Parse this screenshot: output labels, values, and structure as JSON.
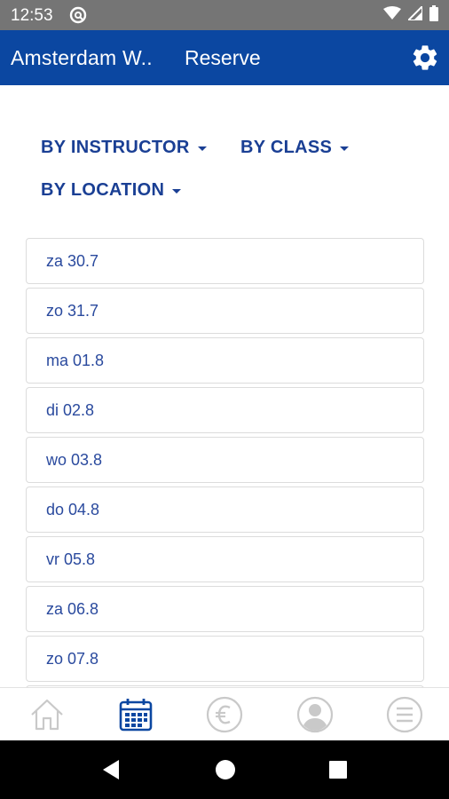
{
  "status_bar": {
    "time": "12:53"
  },
  "app_bar": {
    "title": "Amsterdam W..",
    "subtitle": "Reserve"
  },
  "filters": {
    "by_instructor": "BY INSTRUCTOR",
    "by_class": "BY CLASS",
    "by_location": "BY LOCATION"
  },
  "dates": [
    "za 30.7",
    "zo 31.7",
    "ma 01.8",
    "di 02.8",
    "wo 03.8",
    "do 04.8",
    "vr 05.8",
    "za 06.8",
    "zo 07.8"
  ],
  "bottom_nav": {
    "items": [
      {
        "icon": "home-icon",
        "active": false
      },
      {
        "icon": "calendar-icon",
        "active": true
      },
      {
        "icon": "euro-icon",
        "active": false
      },
      {
        "icon": "profile-icon",
        "active": false
      },
      {
        "icon": "menu-icon",
        "active": false
      }
    ]
  },
  "colors": {
    "app_bar": "#0b47a1",
    "accent_text": "#1a3f94",
    "list_text": "#2a4a9e",
    "nav_active": "#0b47a1",
    "nav_inactive": "#c9c9c9",
    "status_bar": "#757575"
  }
}
